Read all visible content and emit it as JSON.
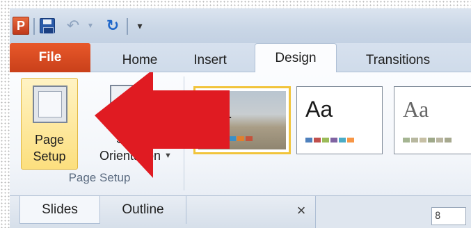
{
  "quick_access": {
    "app_letter": "P",
    "save_icon": "save-icon",
    "undo_icon": "undo-icon",
    "redo_icon": "redo-icon"
  },
  "tabs": [
    {
      "label": "File"
    },
    {
      "label": "Home"
    },
    {
      "label": "Insert"
    },
    {
      "label": "Design"
    },
    {
      "label": "Transitions"
    }
  ],
  "page_setup_group": {
    "page_setup_label": "Page Setup",
    "slide_orientation_label": "Slide Orientation",
    "group_label": "Page Setup"
  },
  "themes": [
    {
      "sample": "Aa",
      "selected": true
    },
    {
      "sample": "Aa"
    },
    {
      "sample": "Aa"
    }
  ],
  "colors": {
    "file_tab": "#d9471f",
    "arrow": "#e01b22",
    "selected_highlight": "#f1c43b"
  },
  "pane": {
    "tabs": [
      {
        "label": "Slides"
      },
      {
        "label": "Outline"
      }
    ],
    "close_glyph": "×",
    "ruler_text": "8"
  }
}
